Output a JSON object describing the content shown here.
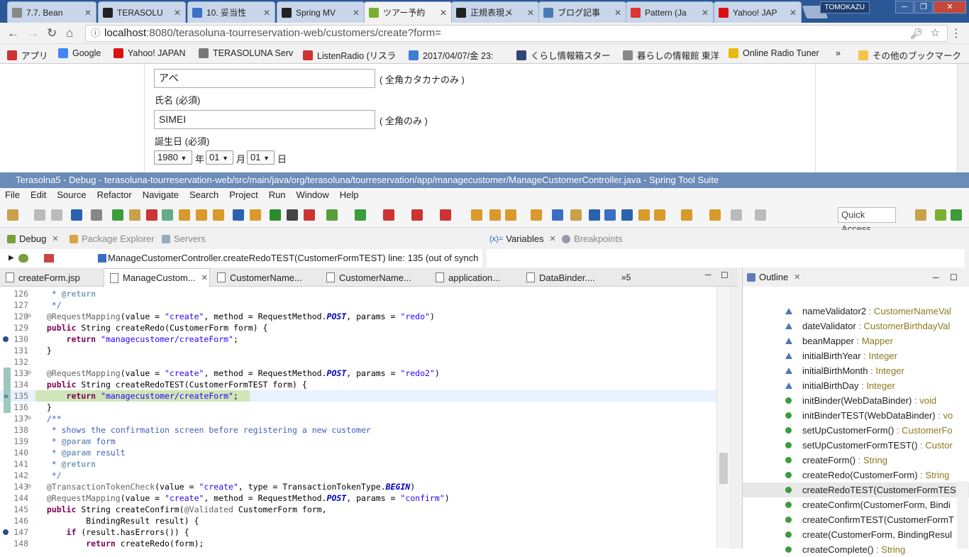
{
  "browser": {
    "tabs": [
      {
        "title": "7.7. Bean"
      },
      {
        "title": "TERASOLU"
      },
      {
        "title": "10. 妥当性"
      },
      {
        "title": "Spring MV"
      },
      {
        "title": "ツアー予約"
      },
      {
        "title": "正規表現メ"
      },
      {
        "title": "ブログ記事"
      },
      {
        "title": "Pattern (Ja"
      },
      {
        "title": "Yahoo! JAP"
      }
    ],
    "user": "TOMOKAZU",
    "url_host": "localhost",
    "url_rest": ":8080/terasoluna-tourreservation-web/customers/create?form=",
    "bookmarks": [
      {
        "label": "アプリ"
      },
      {
        "label": "Google"
      },
      {
        "label": "Yahoo! JAPAN"
      },
      {
        "label": "TERASOLUNA Serv"
      },
      {
        "label": "ListenRadio (リスラ"
      },
      {
        "label": "2017/04/07/金 23:"
      },
      {
        "label": "くらし情報箱スター"
      },
      {
        "label": "暮らしの情報館 東洋"
      },
      {
        "label": "Online Radio Tuner"
      },
      {
        "label": "»"
      },
      {
        "label": "その他のブックマーク"
      }
    ]
  },
  "webpage": {
    "kana_value": "アベ",
    "kana_hint": "( 全角カタカナのみ )",
    "name_label": "氏名 (必須)",
    "name_value": "SIMEI",
    "name_hint": "( 全角のみ )",
    "birth_label": "誕生日 (必須)",
    "birth_year": "1980",
    "year_suffix": "年",
    "birth_month": "01",
    "month_suffix": "月",
    "birth_day": "01",
    "day_suffix": "日"
  },
  "eclipse": {
    "title": "Terasolna5 - Debug - terasoluna-tourreservation-web/src/main/java/org/terasoluna/tourreservation/app/managecustomer/ManageCustomerController.java - Spring Tool Suite",
    "menus": [
      "File",
      "Edit",
      "Source",
      "Refactor",
      "Navigate",
      "Search",
      "Project",
      "Run",
      "Window",
      "Help"
    ],
    "quick_access": "Quick Access",
    "debug_tabs": {
      "debug": "Debug",
      "package_explorer": "Package Explorer",
      "servers": "Servers"
    },
    "var_tabs": {
      "variables": "Variables",
      "breakpoints": "Breakpoints"
    },
    "debug_frame": "ManageCustomerController.createRedoTEST(CustomerFormTEST) line: 135 (out of synch",
    "editor_tabs": [
      {
        "label": "createForm.jsp"
      },
      {
        "label": "ManageCustom..."
      },
      {
        "label": "CustomerName..."
      },
      {
        "label": "CustomerName..."
      },
      {
        "label": "application..."
      },
      {
        "label": "DataBinder...."
      }
    ],
    "more_tabs": "»5",
    "outline_title": "Outline",
    "outline": [
      {
        "name": "nameValidator2",
        "type": " : CustomerNameVal",
        "kind": "field"
      },
      {
        "name": "dateValidator",
        "type": " : CustomerBirthdayVal",
        "kind": "field"
      },
      {
        "name": "beanMapper",
        "type": " : Mapper",
        "kind": "field"
      },
      {
        "name": "initialBirthYear",
        "type": " : Integer",
        "kind": "field"
      },
      {
        "name": "initialBirthMonth",
        "type": " : Integer",
        "kind": "field"
      },
      {
        "name": "initialBirthDay",
        "type": " : Integer",
        "kind": "field"
      },
      {
        "name": "initBinder(WebDataBinder)",
        "type": " : void",
        "kind": "method"
      },
      {
        "name": "initBinderTEST(WebDataBinder)",
        "type": " : vo",
        "kind": "method"
      },
      {
        "name": "setUpCustomerForm()",
        "type": " : CustomerFo",
        "kind": "method"
      },
      {
        "name": "setUpCustomerFormTEST()",
        "type": " : Custor",
        "kind": "method"
      },
      {
        "name": "createForm()",
        "type": " : String",
        "kind": "method"
      },
      {
        "name": "createRedo(CustomerForm)",
        "type": " : String",
        "kind": "method"
      },
      {
        "name": "createRedoTEST(CustomerFormTES",
        "type": "",
        "kind": "method"
      },
      {
        "name": "createConfirm(CustomerForm, Bindi",
        "type": "",
        "kind": "method"
      },
      {
        "name": "createConfirmTEST(CustomerFormT",
        "type": "",
        "kind": "method"
      },
      {
        "name": "create(CustomerForm, BindingResul",
        "type": "",
        "kind": "method"
      },
      {
        "name": "createComplete()",
        "type": " : String",
        "kind": "method"
      }
    ],
    "code_lines": [
      {
        "n": "126",
        "html": "   <span class=\"jd\">* </span><span class=\"jdt\">@return</span>"
      },
      {
        "n": "127",
        "html": "   <span class=\"jd\">*/</span>"
      },
      {
        "n": "128",
        "html": "  <span class=\"ann\">@RequestMapping</span>(value = <span class=\"str\">\"create\"</span>, method = RequestMethod.<span class=\"it\">POST</span>, params = <span class=\"str\">\"redo\"</span>)"
      },
      {
        "n": "129",
        "html": "  <span class=\"kw\">public</span> String createRedo(CustomerForm form) {"
      },
      {
        "n": "130",
        "html": "      <span class=\"kw\">return</span> <span class=\"str\">\"managecustomer/createForm\"</span>;"
      },
      {
        "n": "131",
        "html": "  }"
      },
      {
        "n": "132",
        "html": ""
      },
      {
        "n": "133",
        "html": "  <span class=\"ann\">@RequestMapping</span>(value = <span class=\"str\">\"create\"</span>, method = RequestMethod.<span class=\"it\">POST</span>, params = <span class=\"str\">\"redo2\"</span>)"
      },
      {
        "n": "134",
        "html": "  <span class=\"kw\">public</span> String createRedoTEST(CustomerFormTEST form) {"
      },
      {
        "n": "135",
        "html": "      <span class=\"kw\">return</span> <span class=\"str\">\"managecustomer/createForm\"</span>;"
      },
      {
        "n": "136",
        "html": "  }"
      },
      {
        "n": "137",
        "html": "  <span class=\"jd\">/**</span>"
      },
      {
        "n": "138",
        "html": "   <span class=\"jd\">* shows the confirmation screen before registering a new customer</span>"
      },
      {
        "n": "139",
        "html": "   <span class=\"jd\">* </span><span class=\"jdt\">@param</span><span class=\"jd\"> form</span>"
      },
      {
        "n": "140",
        "html": "   <span class=\"jd\">* </span><span class=\"jdt\">@param</span><span class=\"jd\"> result</span>"
      },
      {
        "n": "141",
        "html": "   <span class=\"jd\">* </span><span class=\"jdt\">@return</span>"
      },
      {
        "n": "142",
        "html": "   <span class=\"jd\">*/</span>"
      },
      {
        "n": "143",
        "html": "  <span class=\"ann\">@TransactionTokenCheck</span>(value = <span class=\"str\">\"create\"</span>, type = TransactionTokenType.<span class=\"it\">BEGIN</span>)"
      },
      {
        "n": "144",
        "html": "  <span class=\"ann\">@RequestMapping</span>(value = <span class=\"str\">\"create\"</span>, method = RequestMethod.<span class=\"it\">POST</span>, params = <span class=\"str\">\"confirm\"</span>)"
      },
      {
        "n": "145",
        "html": "  <span class=\"kw\">public</span> String createConfirm(<span class=\"ann\">@Validated</span> CustomerForm form,"
      },
      {
        "n": "146",
        "html": "          BindingResult result) {"
      },
      {
        "n": "147",
        "html": "      <span class=\"kw\">if</span> (result.hasErrors()) {"
      },
      {
        "n": "148",
        "html": "          <span class=\"kw\">return</span> createRedo(form);"
      }
    ]
  }
}
